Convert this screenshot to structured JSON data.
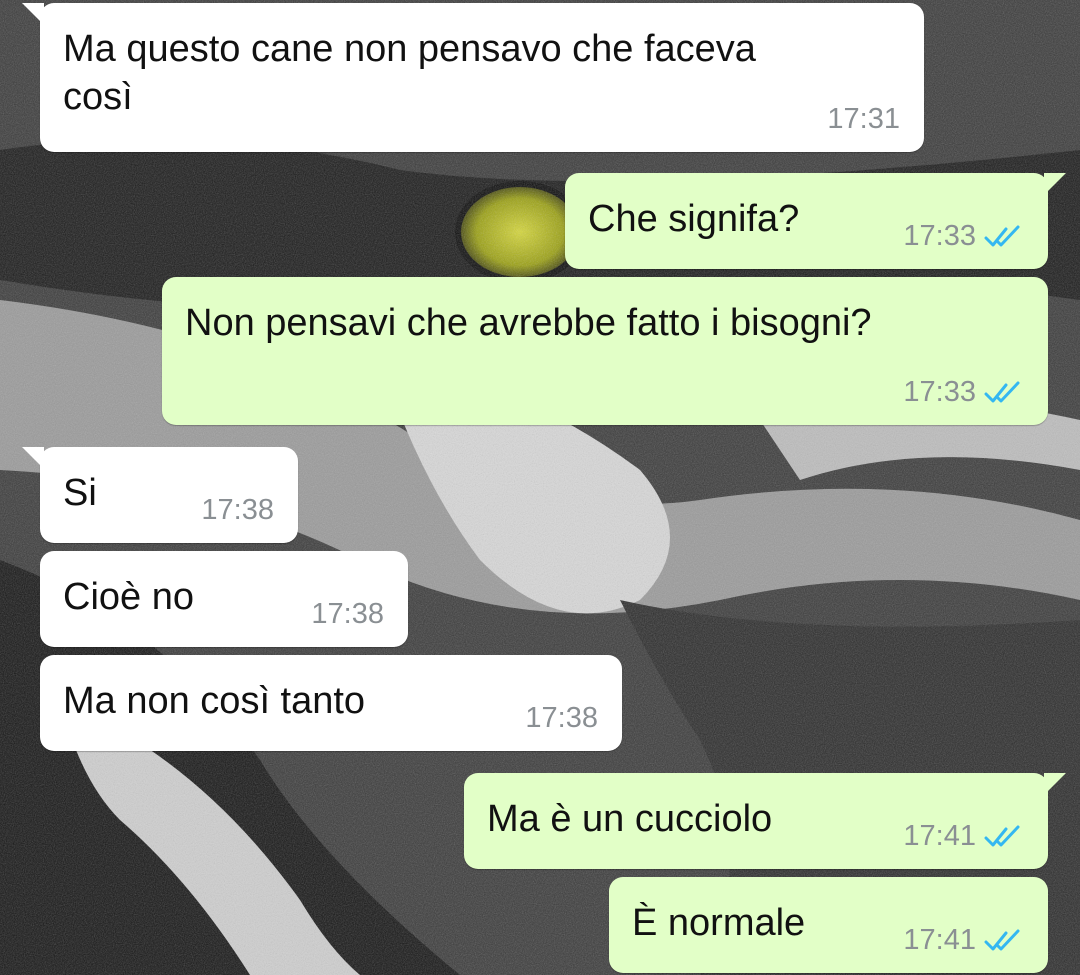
{
  "chat": {
    "wallpaper": {
      "description_icon": "tiger-eye-wallpaper",
      "base_color": "#2a2a2a",
      "eye_color": "#b5b814"
    },
    "colors": {
      "incoming_bubble": "#ffffff",
      "outgoing_bubble": "#e2ffc7",
      "read_tick": "#34b7f1",
      "timestamp": "#8a8f93"
    },
    "messages": [
      {
        "direction": "in",
        "text": "Ma questo cane non pensavo che faceva\ncosì",
        "time": "17:31"
      },
      {
        "direction": "out",
        "text": "Che signifa?",
        "time": "17:33",
        "status_icon": "double-check-read-icon"
      },
      {
        "direction": "out",
        "text": "Non pensavi che avrebbe fatto i bisogni?",
        "time": "17:33",
        "status_icon": "double-check-read-icon"
      },
      {
        "direction": "in",
        "text": "Si",
        "time": "17:38"
      },
      {
        "direction": "in",
        "text": "Cioè no",
        "time": "17:38"
      },
      {
        "direction": "in",
        "text": "Ma non così tanto",
        "time": "17:38"
      },
      {
        "direction": "out",
        "text": "Ma è un cucciolo",
        "time": "17:41",
        "status_icon": "double-check-read-icon"
      },
      {
        "direction": "out",
        "text": "È normale",
        "time": "17:41",
        "status_icon": "double-check-read-icon"
      }
    ]
  }
}
